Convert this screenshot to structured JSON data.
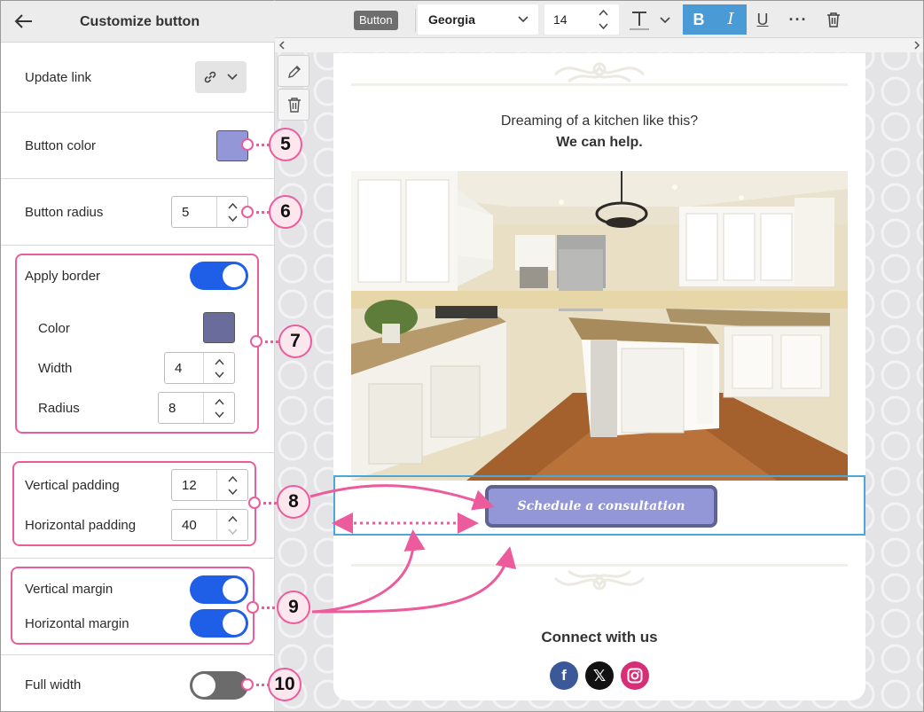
{
  "panel": {
    "title": "Customize button",
    "update_link_label": "Update link",
    "button_color_label": "Button color",
    "button_color": "#9397d8",
    "button_radius_label": "Button radius",
    "button_radius": "5",
    "apply_border_label": "Apply border",
    "apply_border_on": true,
    "border_color_label": "Color",
    "border_color": "#6a6d9c",
    "border_width_label": "Width",
    "border_width": "4",
    "border_radius_label": "Radius",
    "border_radius": "8",
    "vertical_padding_label": "Vertical padding",
    "vertical_padding": "12",
    "horizontal_padding_label": "Horizontal padding",
    "horizontal_padding": "40",
    "vertical_margin_label": "Vertical margin",
    "vertical_margin_on": true,
    "horizontal_margin_label": "Horizontal margin",
    "horizontal_margin_on": true,
    "full_width_label": "Full width",
    "full_width_on": false
  },
  "toolbar": {
    "tag": "Button",
    "font": "Georgia",
    "size": "14",
    "bold_active": true,
    "italic_active": true
  },
  "email": {
    "line1": "Dreaming of a kitchen like this?",
    "line2": "We can help.",
    "cta_label": "Schedule a consultation",
    "connect_label": "Connect with us",
    "social": [
      "facebook-icon",
      "x-icon",
      "instagram-icon"
    ]
  },
  "callouts": [
    "5",
    "6",
    "7",
    "8",
    "9",
    "10"
  ],
  "colors": {
    "accent_pink": "#ec5c9d",
    "toggle_on": "#1f5fe8",
    "active_format": "#4a9ad6",
    "selection_border": "#4ea6d6"
  }
}
